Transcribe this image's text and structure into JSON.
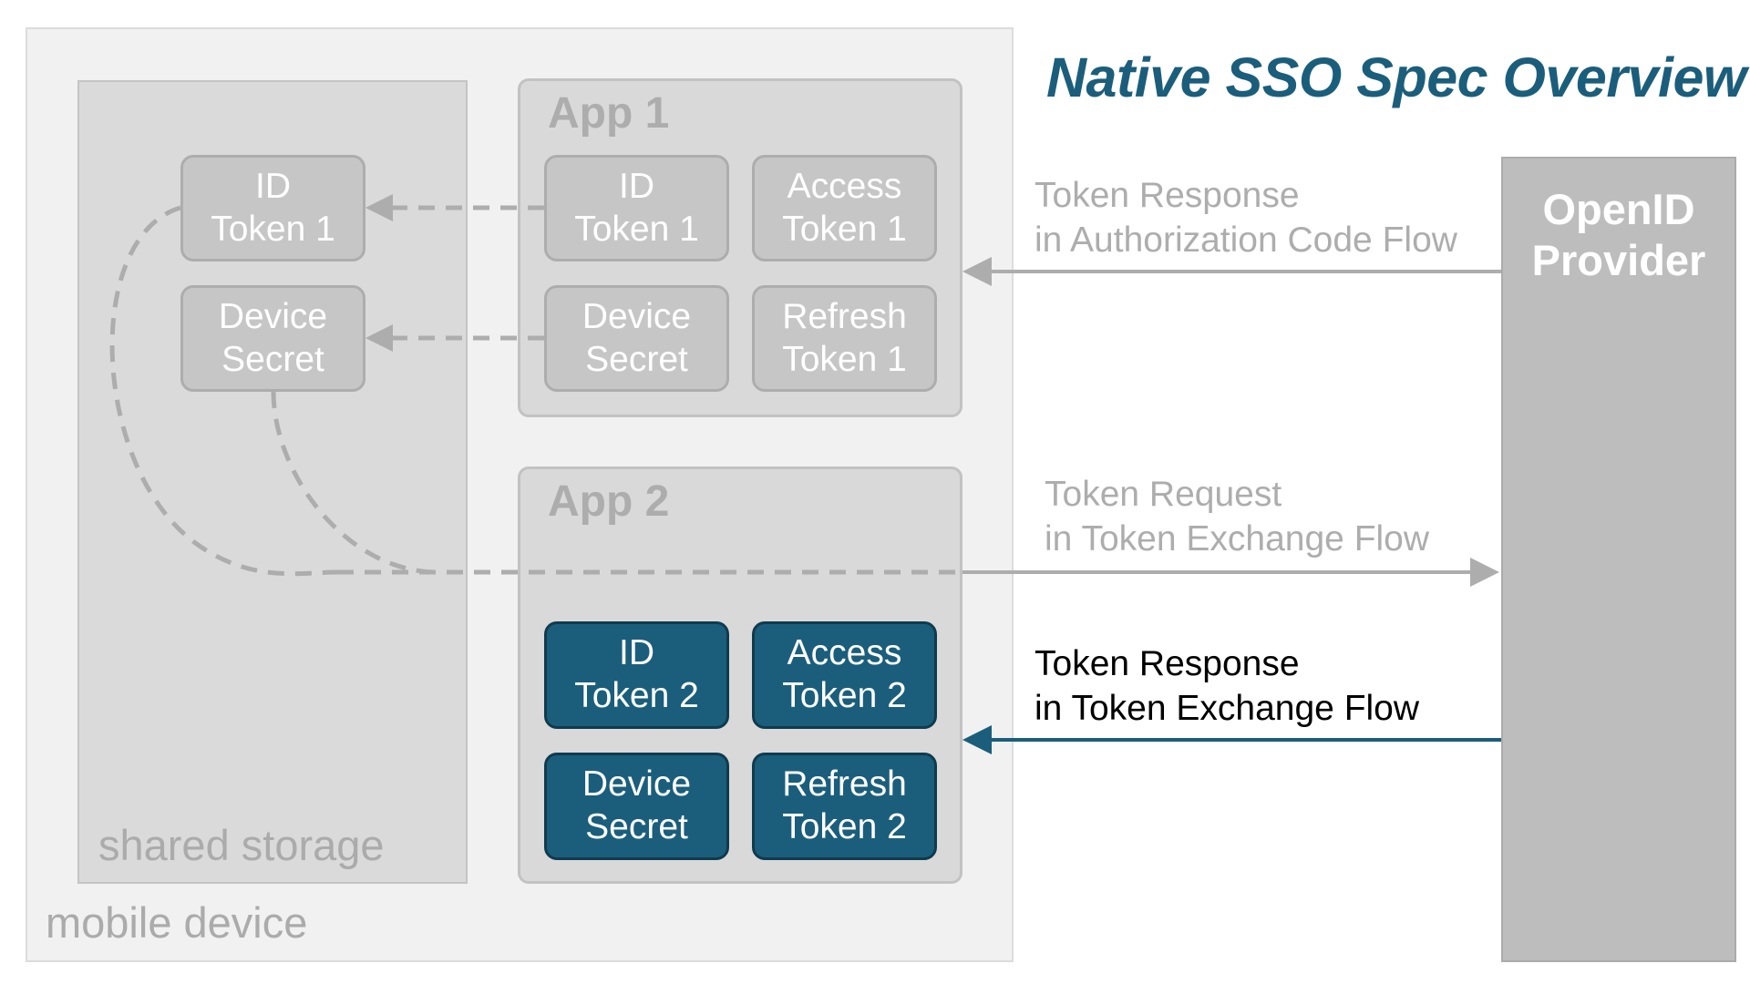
{
  "title": "Native SSO Spec Overview",
  "mobile_device": {
    "label": "mobile device"
  },
  "shared_storage": {
    "label": "shared storage",
    "tokens": {
      "id_token": "ID\nToken 1",
      "device_secret": "Device\nSecret"
    }
  },
  "app1": {
    "title": "App 1",
    "tokens": {
      "id_token": "ID\nToken 1",
      "access_token": "Access\nToken 1",
      "device_secret": "Device\nSecret",
      "refresh_token": "Refresh\nToken 1"
    }
  },
  "app2": {
    "title": "App 2",
    "tokens": {
      "id_token": "ID\nToken 2",
      "access_token": "Access\nToken 2",
      "device_secret": "Device\nSecret",
      "refresh_token": "Refresh\nToken 2"
    }
  },
  "provider": {
    "label": "OpenID\nProvider"
  },
  "flows": {
    "auth_code_response": "Token Response\nin Authorization Code Flow",
    "exchange_request": "Token Request\nin Token Exchange Flow",
    "exchange_response": "Token Response\nin Token Exchange Flow"
  },
  "colors": {
    "accent": "#1b5e7b",
    "grey_arrow": "#adadad",
    "grey_box": "#c6c6c6"
  }
}
